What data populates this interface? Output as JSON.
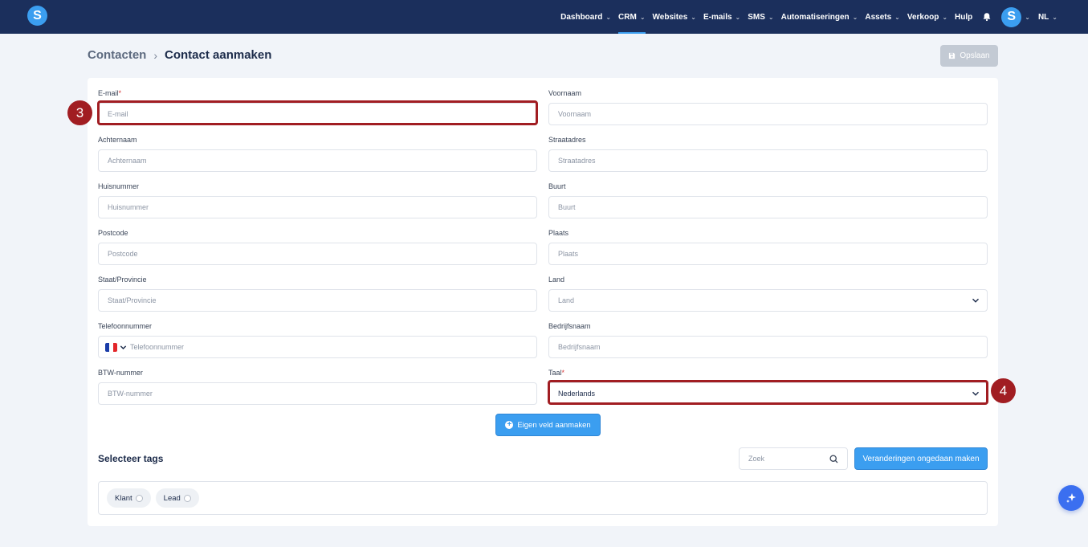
{
  "nav": {
    "items": [
      {
        "label": "Dashboard",
        "dropdown": true,
        "active": false
      },
      {
        "label": "CRM",
        "dropdown": true,
        "active": true
      },
      {
        "label": "Websites",
        "dropdown": true,
        "active": false
      },
      {
        "label": "E-mails",
        "dropdown": true,
        "active": false
      },
      {
        "label": "SMS",
        "dropdown": true,
        "active": false
      },
      {
        "label": "Automatiseringen",
        "dropdown": true,
        "active": false
      },
      {
        "label": "Assets",
        "dropdown": true,
        "active": false
      },
      {
        "label": "Verkoop",
        "dropdown": true,
        "active": false
      },
      {
        "label": "Hulp",
        "dropdown": false,
        "active": false
      }
    ],
    "logo_letter": "S",
    "avatar_letter": "S",
    "language": "NL"
  },
  "header": {
    "breadcrumb_parent": "Contacten",
    "breadcrumb_current": "Contact aanmaken",
    "save_label": "Opslaan"
  },
  "form": {
    "email": {
      "label": "E-mail",
      "required": "*",
      "placeholder": "E-mail"
    },
    "voornaam": {
      "label": "Voornaam",
      "placeholder": "Voornaam"
    },
    "achternaam": {
      "label": "Achternaam",
      "placeholder": "Achternaam"
    },
    "straatadres": {
      "label": "Straatadres",
      "placeholder": "Straatadres"
    },
    "huisnummer": {
      "label": "Huisnummer",
      "placeholder": "Huisnummer"
    },
    "buurt": {
      "label": "Buurt",
      "placeholder": "Buurt"
    },
    "postcode": {
      "label": "Postcode",
      "placeholder": "Postcode"
    },
    "plaats": {
      "label": "Plaats",
      "placeholder": "Plaats"
    },
    "staat": {
      "label": "Staat/Provincie",
      "placeholder": "Staat/Provincie"
    },
    "land": {
      "label": "Land",
      "placeholder": "Land"
    },
    "telefoon": {
      "label": "Telefoonnummer",
      "placeholder": "Telefoonnummer"
    },
    "bedrijfsnaam": {
      "label": "Bedrijfsnaam",
      "placeholder": "Bedrijfsnaam"
    },
    "btw": {
      "label": "BTW-nummer",
      "placeholder": "BTW-nummer"
    },
    "taal": {
      "label": "Taal",
      "required": "*",
      "value": "Nederlands"
    },
    "custom_field_label": "Eigen veld aanmaken"
  },
  "tags": {
    "title": "Selecteer tags",
    "search_placeholder": "Zoek",
    "undo_label": "Veranderingen ongedaan maken",
    "items": [
      "Klant",
      "Lead"
    ]
  },
  "annotations": {
    "marker_email": "3",
    "marker_taal": "4"
  },
  "colors": {
    "nav_bg": "#1b2f5c",
    "accent": "#3b9ef0",
    "highlight": "#a11d22"
  }
}
